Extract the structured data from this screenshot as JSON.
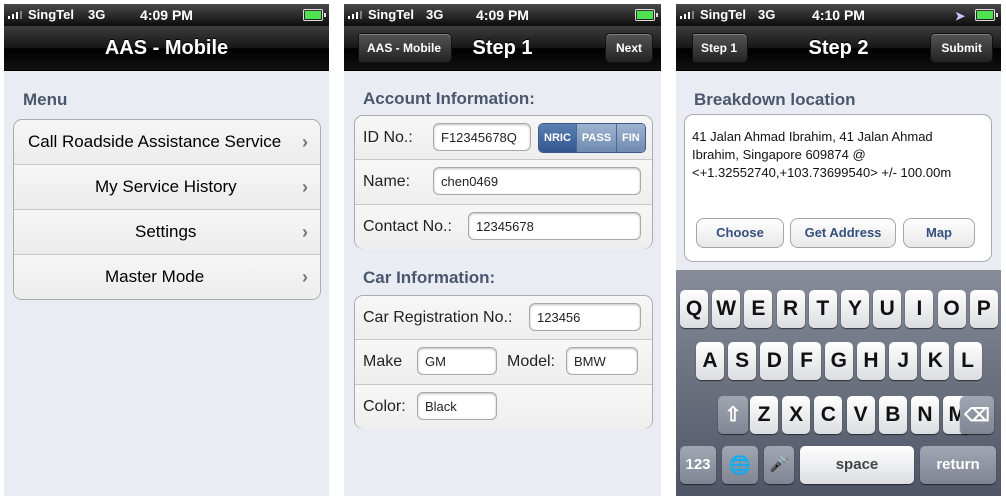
{
  "screen1": {
    "status": {
      "carrier": "SingTel",
      "network": "3G",
      "time": "4:09 PM"
    },
    "nav_title": "AAS - Mobile",
    "section": "Menu",
    "menu": [
      {
        "label": "Call Roadside Assistance Service"
      },
      {
        "label": "My Service History"
      },
      {
        "label": "Settings"
      },
      {
        "label": "Master Mode"
      }
    ]
  },
  "screen2": {
    "status": {
      "carrier": "SingTel",
      "network": "3G",
      "time": "4:09 PM"
    },
    "nav_title": "Step 1",
    "back_label": "AAS - Mobile",
    "next_label": "Next",
    "account_section": "Account Information:",
    "id_label": "ID No.:",
    "id_value": "F12345678Q",
    "id_type_options": [
      "NRIC",
      "PASS",
      "FIN"
    ],
    "id_type_selected": "NRIC",
    "name_label": "Name:",
    "name_value": "chen0469",
    "contact_label": "Contact No.:",
    "contact_value": "12345678",
    "car_section": "Car Information:",
    "reg_label": "Car Registration No.:",
    "reg_value": "123456",
    "make_label": "Make",
    "make_value": "GM",
    "model_label": "Model:",
    "model_value": "BMW",
    "color_label": "Color:",
    "color_value": "Black"
  },
  "screen3": {
    "status": {
      "carrier": "SingTel",
      "network": "3G",
      "time": "4:10 PM"
    },
    "nav_title": "Step 2",
    "back_label": "Step 1",
    "submit_label": "Submit",
    "section": "Breakdown location",
    "location_text": "41 Jalan Ahmad Ibrahim, 41 Jalan Ahmad Ibrahim, Singapore 609874 @ <+1.32552740,+103.73699540> +/- 100.00m",
    "choose_label": "Choose",
    "get_address_label": "Get Address",
    "map_label": "Map",
    "keyboard": {
      "row1": [
        "Q",
        "W",
        "E",
        "R",
        "T",
        "Y",
        "U",
        "I",
        "O",
        "P"
      ],
      "row2": [
        "A",
        "S",
        "D",
        "F",
        "G",
        "H",
        "J",
        "K",
        "L"
      ],
      "row3": [
        "Z",
        "X",
        "C",
        "V",
        "B",
        "N",
        "M"
      ],
      "numbers_label": "123",
      "space_label": "space",
      "return_label": "return"
    }
  }
}
